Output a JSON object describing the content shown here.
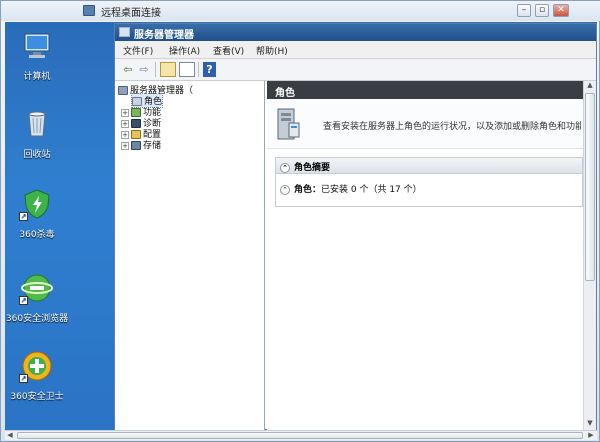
{
  "rdp": {
    "title": "远程桌面连接",
    "buttons": {
      "minimize": "–",
      "restore": "▫",
      "close": "✕"
    }
  },
  "desktop": {
    "icons": [
      {
        "label": "计算机"
      },
      {
        "label": "回收站"
      },
      {
        "label": "360杀毒"
      },
      {
        "label": "360安全浏览器"
      },
      {
        "label": "360安全卫士"
      }
    ]
  },
  "window": {
    "title": "服务器管理器",
    "menu": [
      "文件(F)",
      "操作(A)",
      "查看(V)",
      "帮助(H)"
    ],
    "tree": {
      "root": "服务器管理器（",
      "items": [
        {
          "label": "角色",
          "expandable": false,
          "selected": true
        },
        {
          "label": "功能",
          "expandable": true
        },
        {
          "label": "诊断",
          "expandable": true
        },
        {
          "label": "配置",
          "expandable": true
        },
        {
          "label": "存储",
          "expandable": true
        }
      ]
    },
    "content": {
      "header": "角色",
      "description": "查看安装在服务器上角色的运行状况，以及添加或删除角色和功能",
      "section_title": "角色摘要",
      "summary_label": "角色：",
      "summary_value": "已安装 0 个（共 17 个）"
    }
  },
  "colors": {
    "desktop": "#2b73c5",
    "titlebar": "#1f4f8c",
    "header_dark": "#3a3d42"
  }
}
